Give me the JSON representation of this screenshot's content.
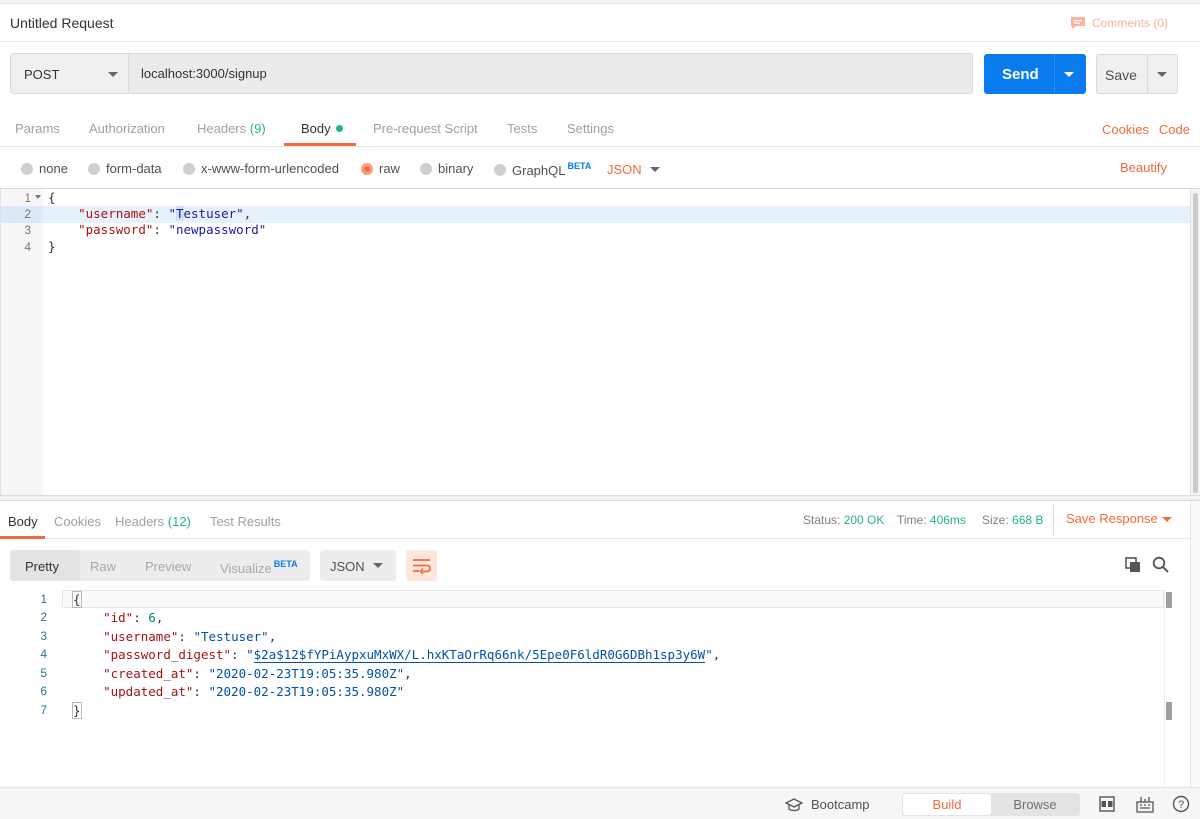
{
  "request": {
    "title": "Untitled Request",
    "comments_label": "Comments (0)",
    "method": "POST",
    "url": "localhost:3000/signup",
    "send_label": "Send",
    "save_label": "Save"
  },
  "request_tabs": {
    "params": "Params",
    "authorization": "Authorization",
    "headers": "Headers",
    "headers_count": "(9)",
    "body": "Body",
    "prerequest": "Pre-request Script",
    "tests": "Tests",
    "settings": "Settings",
    "cookies": "Cookies",
    "code": "Code"
  },
  "body_types": {
    "none": "none",
    "form_data": "form-data",
    "urlencoded": "x-www-form-urlencoded",
    "raw": "raw",
    "binary": "binary",
    "graphql": "GraphQL",
    "beta": "BETA",
    "format": "JSON",
    "beautify": "Beautify",
    "selected": "raw"
  },
  "request_body": {
    "line_numbers": [
      "1",
      "2",
      "3",
      "4"
    ],
    "open": "{",
    "username_key": "\"username\"",
    "username_val_first": "\"",
    "username_val_cursor": "T",
    "username_val_rest": "estuser\"",
    "password_key": "\"password\"",
    "password_val": "\"newpassword\"",
    "close": "}"
  },
  "response_tabs": {
    "body": "Body",
    "cookies": "Cookies",
    "headers": "Headers",
    "headers_count": "(12)",
    "test_results": "Test Results",
    "status_label": "Status:",
    "status_value": "200 OK",
    "time_label": "Time:",
    "time_value": "406ms",
    "size_label": "Size:",
    "size_value": "668 B",
    "save_response": "Save Response"
  },
  "response_view": {
    "pretty": "Pretty",
    "raw": "Raw",
    "preview": "Preview",
    "visualize": "Visualize",
    "beta": "BETA",
    "format": "JSON"
  },
  "response_body": {
    "line_numbers": [
      "1",
      "2",
      "3",
      "4",
      "5",
      "6",
      "7"
    ],
    "open": "{",
    "id_key": "\"id\"",
    "id_val": "6",
    "username_key": "\"username\"",
    "username_val": "\"Testuser\"",
    "digest_key": "\"password_digest\"",
    "digest_val_q": "\"",
    "digest_val": "$2a$12$fYPiAypxuMxWX/L.hxKTaOrRq66nk/5Epe0F6ldR0G6DBh1sp3y6W",
    "created_key": "\"created_at\"",
    "created_val": "\"2020-02-23T19:05:35.980Z\"",
    "updated_key": "\"updated_at\"",
    "updated_val": "\"2020-02-23T19:05:35.980Z\"",
    "close": "}"
  },
  "footer": {
    "bootcamp": "Bootcamp",
    "build": "Build",
    "browse": "Browse"
  },
  "colors": {
    "accent": "#f26b3a",
    "send": "#097bed",
    "success": "#26b47f"
  }
}
